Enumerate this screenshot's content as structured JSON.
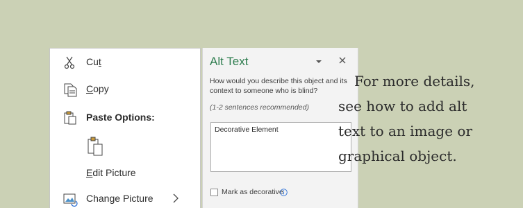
{
  "context_menu": {
    "items": [
      {
        "icon": "scissors-icon",
        "label_before": "Cu",
        "label_underlined": "t",
        "label_after": ""
      },
      {
        "icon": "copy-icon",
        "label_before": "",
        "label_underlined": "C",
        "label_after": "opy"
      },
      {
        "icon": "paste-icon",
        "label": "Paste Options:"
      },
      {
        "icon": "paste-option-picture-icon"
      },
      {
        "label_before": "",
        "label_underlined": "E",
        "label_after": "dit Picture"
      },
      {
        "icon": "change-picture-icon",
        "label_before": "Chan",
        "label_underlined": "g",
        "label_after": "e Picture",
        "submenu": true
      }
    ]
  },
  "alt_text_pane": {
    "title": "Alt Text",
    "question": "How would you describe this object and its context to someone who is blind?",
    "hint": "(1-2 sentences recommended)",
    "textarea_value": "Decorative Element",
    "decorative_checkbox_label": "Mark as decorative",
    "decorative_checked": false
  },
  "caption": {
    "lines": [
      "For more details,",
      "see how to add alt",
      "text to an image or",
      "graphical object."
    ]
  },
  "colors": {
    "background": "#cbd1b5",
    "pane_title": "#2e7d4f",
    "info_icon": "#2b6fd6"
  }
}
